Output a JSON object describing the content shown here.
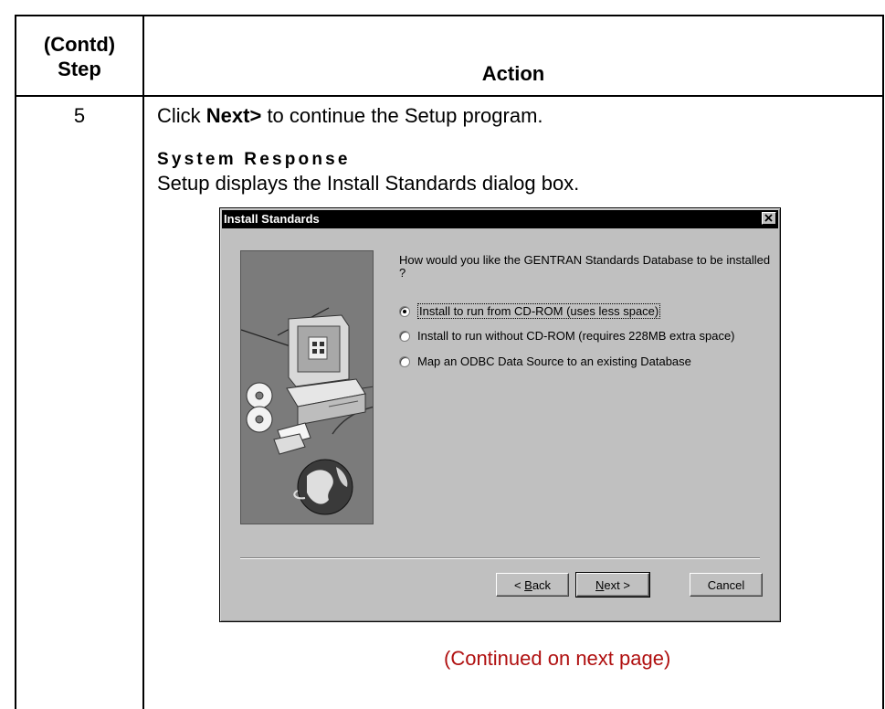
{
  "table": {
    "step_header_line1": "(Contd)",
    "step_header_line2": "Step",
    "action_header": "Action"
  },
  "row": {
    "step_number": "5",
    "action_before": "Click ",
    "action_bold": "Next>",
    "action_after": " to continue the Setup program.",
    "system_response_title": "System Response",
    "system_response_text": "Setup displays the Install Standards dialog box."
  },
  "dialog": {
    "title": "Install Standards",
    "prompt": "How would you like the GENTRAN Standards Database to be installed ?",
    "options": [
      {
        "label": "Install to run from CD-ROM (uses less space)",
        "checked": true
      },
      {
        "label": "Install to run without CD-ROM (requires 228MB extra space)",
        "checked": false
      },
      {
        "label": "Map an ODBC Data Source to an existing Database",
        "checked": false
      }
    ],
    "buttons": {
      "back_mnemonic": "B",
      "back_rest": "ack",
      "back_prefix": "< ",
      "next_mnemonic": "N",
      "next_rest": "ext >",
      "cancel": "Cancel"
    }
  },
  "footer": {
    "continued": "(Continued on next page)"
  },
  "colors": {
    "continued_text": "#b01010",
    "dialog_face": "#c0c0c0",
    "titlebar": "#000000"
  }
}
